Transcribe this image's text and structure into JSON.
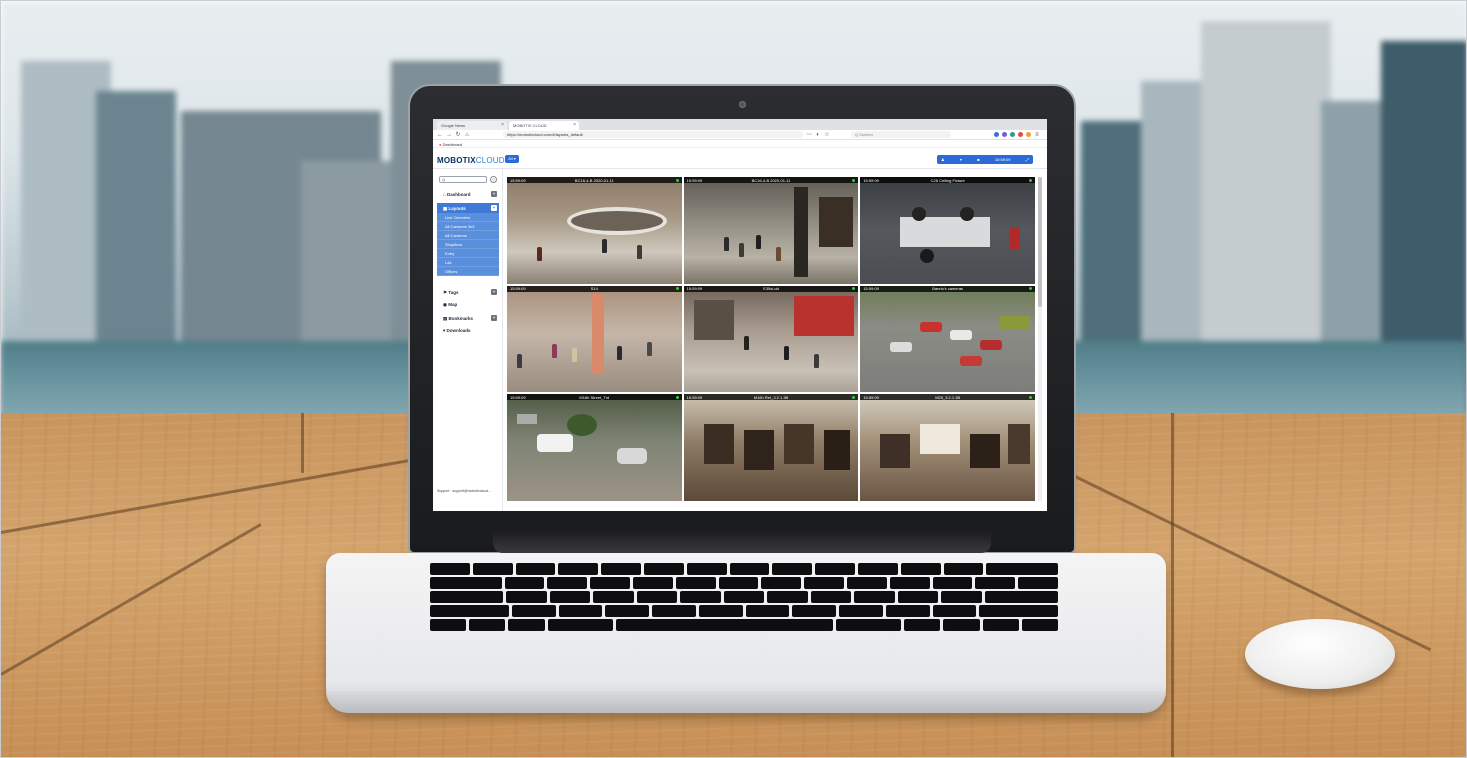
{
  "browser": {
    "tabs": [
      {
        "label": "Google News"
      },
      {
        "label": "MOBOTIX CLOUD"
      }
    ],
    "url": "https://mobotixcloud.com/#/layouts_default",
    "search_placeholder": "Q Suchen",
    "bookmark": "Dashboard"
  },
  "app": {
    "brand": "MOBOTIX",
    "brand_suffix": "CLOUD",
    "header_button": "All ▾",
    "header_right": {
      "user": "▾",
      "time": "15:59:09"
    }
  },
  "sidebar": {
    "search_placeholder": "Q",
    "help": "?",
    "items": [
      {
        "label": "Dashboard",
        "icon": "dashboard-icon",
        "plus": "+"
      },
      {
        "label": "Layouts",
        "icon": "layouts-icon",
        "plus": "+"
      },
      {
        "label": "Tags",
        "icon": "tags-icon",
        "plus": "+"
      },
      {
        "label": "Map",
        "icon": "map-icon"
      },
      {
        "label": "Bookmarks",
        "icon": "bookmark-icon",
        "plus": "+"
      },
      {
        "label": "Downloads",
        "icon": "downloads-icon"
      }
    ],
    "layouts_sub": [
      "Live Overview",
      "All Cameras 3x3",
      "All Cameras",
      "Shopfloor",
      "Entry",
      "L&L",
      "Offices"
    ],
    "support": "Support · support@mobotixcloud..."
  },
  "cameras": [
    {
      "time": "15:59:09",
      "name": "BC16-4-B 2020-01-11"
    },
    {
      "time": "15:59:09",
      "name": "BC16-4-B 2020-01-11"
    },
    {
      "time": "15:59:09",
      "name": "C26 Ceiling Fixture"
    },
    {
      "time": "15:59:09",
      "name": "S14"
    },
    {
      "time": "15:59:09",
      "name": "E35si-dd"
    },
    {
      "time": "15:59:09",
      "name": "Barelo's cameras"
    },
    {
      "time": "15:59:09",
      "name": "M16h Street_Trd"
    },
    {
      "time": "15:59:09",
      "name": "M16h Ret_3.2.1.3B"
    },
    {
      "time": "15:59:09",
      "name": "M25_3.2.1.3B"
    }
  ],
  "colors": {
    "accent": "#2c6ad8",
    "brand_dark": "#0d2e66",
    "sidebar_active": "#3f7bd6",
    "rec_indicator": "#2ecc40"
  }
}
